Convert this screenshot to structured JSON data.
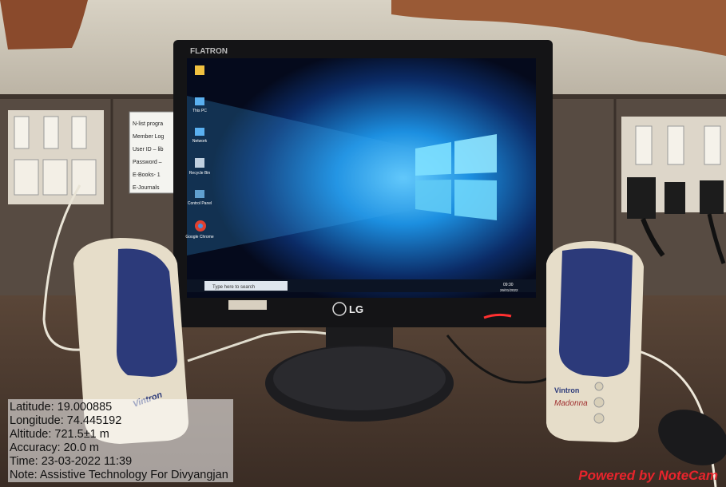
{
  "photo": {
    "monitor_brand": "FLATRON",
    "monitor_logo": "LG",
    "speaker_brand_left": "Vintron",
    "speaker_brand_right": "Vintron",
    "speaker_model": "Madonna",
    "desktop_icons": [
      "This PC",
      "Network",
      "Recycle Bin",
      "Control Panel",
      "Google Chrome"
    ],
    "taskbar_search": "Type here to search",
    "taskbar_time": "09:30",
    "taskbar_date": "26/01/2022",
    "notice_lines": [
      "N-list progra",
      "Member Log",
      "User ID – lib",
      "Password –",
      "E-Books- 1",
      "E-Journals"
    ]
  },
  "stamp": {
    "latitude": "Latitude: 19.000885",
    "longitude": "Longitude: 74.445192",
    "altitude": "Altitude: 721.5±1 m",
    "accuracy": "Accuracy: 20.0 m",
    "time": "Time: 23-03-2022 11:39",
    "note": "Note: Assistive Technology For Divyangjan",
    "brand": "Powered by NoteCam"
  },
  "colors": {
    "wall": "#c9c2b5",
    "panel": "#5a4e45",
    "desk": "#4a3a30",
    "screen_blue": "#1e8fe0",
    "speaker_body": "#e6ddc9",
    "speaker_grille": "#2c3a7a",
    "brand_red": "#e8242c"
  }
}
